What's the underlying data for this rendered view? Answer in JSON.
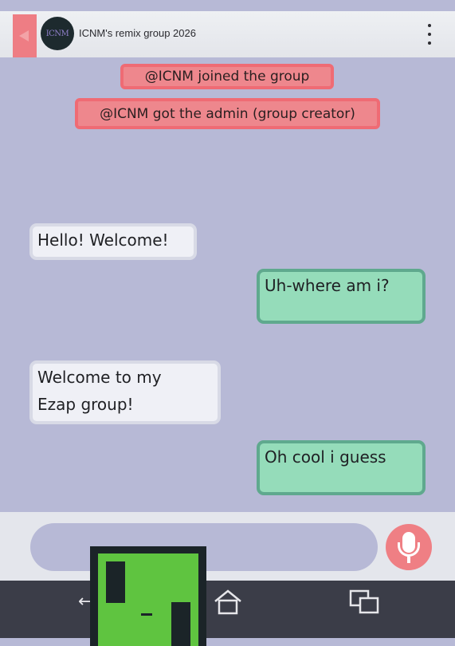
{
  "header": {
    "back_icon": "back-triangle-icon",
    "avatar_text": "ICNM",
    "title": "ICNM's remix group 2026",
    "menu_icon": "vertical-dots-icon"
  },
  "system_messages": [
    "@ICNM joined the group",
    "@ICNM got the admin (group creator)"
  ],
  "messages": [
    {
      "side": "left",
      "lines": [
        "Hello! Welcome!"
      ]
    },
    {
      "side": "right",
      "lines": [
        "Uh-where am i?"
      ]
    },
    {
      "side": "left",
      "lines": [
        "Welcome to my",
        "Ezap group!"
      ]
    },
    {
      "side": "right",
      "lines": [
        "Oh cool i guess"
      ]
    }
  ],
  "composer": {
    "placeholder": "",
    "mic_icon": "microphone-icon"
  },
  "navbar": {
    "back_icon": "nav-back-icon",
    "home_icon": "home-icon",
    "recents_icon": "recents-icon"
  },
  "colors": {
    "background": "#b7b9d6",
    "accent": "#ee7d84",
    "left_bubble": "#eff0f6",
    "right_bubble": "#95dcba"
  }
}
